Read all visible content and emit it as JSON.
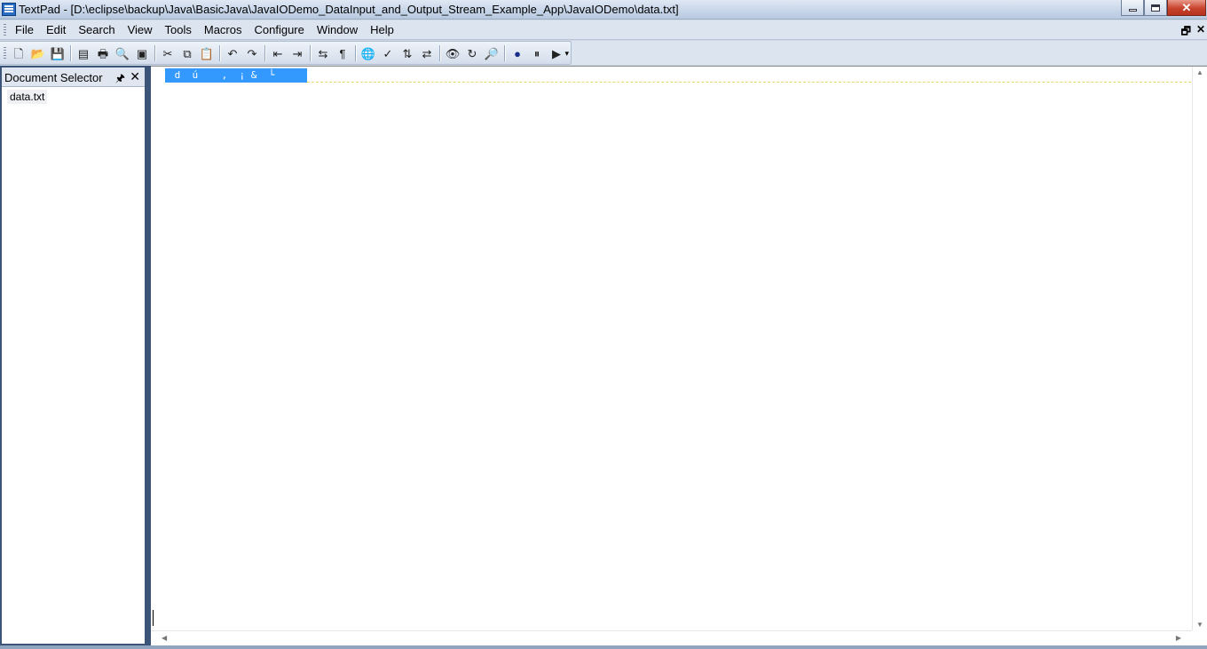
{
  "window": {
    "title": "TextPad - [D:\\eclipse\\backup\\Java\\BasicJava\\JavaIODemo_DataInput_and_Output_Stream_Example_App\\JavaIODemo\\data.txt]",
    "min_glyph": "",
    "close_glyph": "✕"
  },
  "menu": {
    "items": [
      "File",
      "Edit",
      "Search",
      "View",
      "Tools",
      "Macros",
      "Configure",
      "Window",
      "Help"
    ],
    "mdi_restore": "🗗",
    "mdi_close": "✕"
  },
  "toolbar": {
    "icons": [
      "new-file",
      "open-file",
      "save",
      "sep",
      "print-setup",
      "print",
      "print-preview",
      "word-wrap",
      "sep",
      "cut",
      "copy",
      "paste",
      "sep",
      "undo",
      "redo",
      "sep",
      "indent",
      "outdent",
      "sep",
      "wrap-lines",
      "show-paragraph",
      "sep",
      "browser",
      "spell-check",
      "sort",
      "compare",
      "sep",
      "find",
      "replace",
      "find-in-files",
      "sep",
      "record-macro",
      "pause-macro",
      "play-macro"
    ],
    "glyphs": {
      "new-file": "🗋",
      "open-file": "📂",
      "save": "💾",
      "print-setup": "▤",
      "print": "🖶",
      "print-preview": "🔍",
      "word-wrap": "▣",
      "cut": "✂",
      "copy": "⧉",
      "paste": "📋",
      "undo": "↶",
      "redo": "↷",
      "indent": "⇤",
      "outdent": "⇥",
      "wrap-lines": "⇆",
      "show-paragraph": "¶",
      "browser": "🌐",
      "spell-check": "✓",
      "sort": "⇅",
      "compare": "⇄",
      "find": "👁",
      "replace": "↻",
      "find-in-files": "🔎",
      "record-macro": "●",
      "pause-macro": "⏸",
      "play-macro": "▶"
    },
    "overflow": "▾"
  },
  "document_selector": {
    "title": "Document Selector",
    "pin": "🖈",
    "close": "✕",
    "files": [
      "data.txt"
    ]
  },
  "editor": {
    "content": " d  ú    ‚  ¡ &  └"
  }
}
